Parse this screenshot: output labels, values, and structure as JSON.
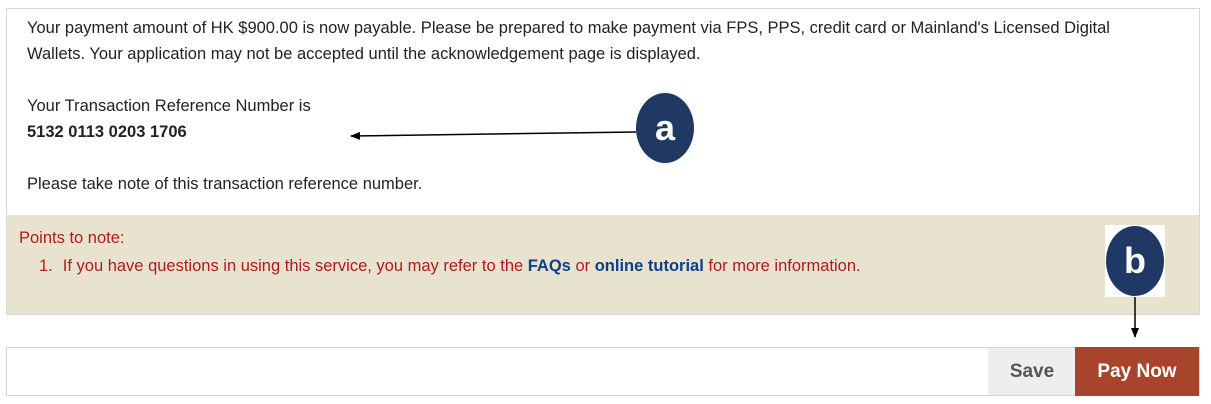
{
  "info": {
    "line1": "Your payment amount of HK $900.00 is now payable. Please be prepared to make payment via FPS, PPS, credit card or Mainland's Licensed Digital",
    "line2": "Wallets. Your application may not be accepted until the acknowledgement page is displayed.",
    "ref_label": "Your Transaction Reference Number is",
    "ref_number": "5132 0113 0203 1706",
    "take_note": "Please take note of this transaction reference number."
  },
  "notes": {
    "title": "Points to note:",
    "item_number": "1.",
    "item_prefix": "If you have questions in using this service, you may refer to the ",
    "faqs_link": "FAQs",
    "or_text": " or ",
    "tutorial_link": "online tutorial",
    "item_suffix": " for more information."
  },
  "actions": {
    "save_label": "Save",
    "pay_label": "Pay Now"
  },
  "callouts": {
    "a": "a",
    "b": "b"
  },
  "colors": {
    "notes_background": "#e8e3cf",
    "notes_text": "#b31a1a",
    "link": "#0b3f8c",
    "pay_button": "#a8432c",
    "callout": "#1f3864"
  }
}
